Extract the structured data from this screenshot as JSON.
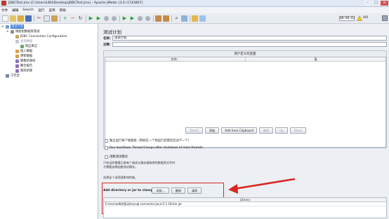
{
  "window": {
    "title": "JDBCTest.jmx (C:\\Users\\LBH\\Desktop\\JDBCTest.jmx) - Apache JMeter (3.0 r1743807)",
    "min_glyph": "–",
    "max_glyph": "□",
    "close_glyph": "✕"
  },
  "menu": [
    "文件",
    "编辑",
    "Search",
    "运行",
    "选项",
    "帮助"
  ],
  "toolbar": {
    "timer": "00:00:03",
    "counter": "0/0",
    "icons": [
      "new-icon",
      "templates-icon",
      "open-icon",
      "save-icon",
      "cut-icon",
      "copy-icon",
      "paste-icon",
      "expand-icon",
      "collapse-icon",
      "toggle-icon",
      "start-icon",
      "start-no-pause-icon",
      "stop-icon",
      "shutdown-icon",
      "remote-start-icon",
      "remote-stop-icon",
      "remote-shutdown-icon",
      "clear-icon",
      "clear-all-icon",
      "search-icon",
      "reset-search-icon",
      "function-helper-icon",
      "help-icon"
    ]
  },
  "tree": {
    "items": [
      {
        "label": "测试计划",
        "state": "selected"
      },
      {
        "label": "线程组数据库测试",
        "state": "normal"
      },
      {
        "label": "JDBC Connection Configuration",
        "state": "normal"
      },
      {
        "label": "查询数据",
        "state": "disabled"
      },
      {
        "label": "响应断言",
        "state": "normal"
      },
      {
        "label": "插入数据",
        "state": "normal"
      },
      {
        "label": "更新数据",
        "state": "normal"
      },
      {
        "label": "察看结果树",
        "state": "normal"
      },
      {
        "label": "聚合报告",
        "state": "normal"
      },
      {
        "label": "图形结果",
        "state": "normal"
      },
      {
        "label": "工作台",
        "state": "normal"
      }
    ]
  },
  "panel": {
    "title": "测试计划",
    "name_label": "名称：",
    "name_value": "测试计划",
    "comment_label": "注释：",
    "comment_value": "",
    "vars_title": "用户定义的变量",
    "vars_columns": [
      "名称：",
      "值"
    ],
    "buttons": {
      "detail": "Detail",
      "add": "添加",
      "add_clipboard": "Add from Clipboard",
      "delete": "删除",
      "up": "Up",
      "down": "Down"
    },
    "checks": {
      "serialize": "独立运行每个线程组（例如在一个组运行结束后启动下一个）",
      "teardown": "Run tearDown Thread Groups after shutdown of main threads",
      "functional": "函数测试模式"
    },
    "notes": [
      "只有当你需要记录每个请求从服务器取得的数据到文件时",
      "才需要选择函数测试模式。",
      "选择这个选项很影响性能。"
    ],
    "classpath": {
      "label": "Add directory or jar to classpath",
      "browse": "浏览...",
      "delete": "删除",
      "clear": "清除",
      "library_header": "Library",
      "library_rows": [
        "E:\\mariadb的驱动\\mysql-connector-java-5.1.18-bin.jar"
      ]
    }
  },
  "colors": {
    "highlight_box": "#d8261f",
    "arrow": "#d8261f",
    "selection": "#3875d7"
  }
}
